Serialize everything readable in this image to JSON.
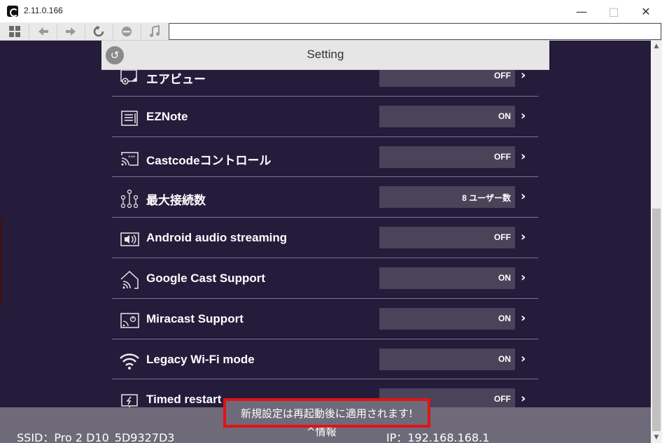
{
  "window": {
    "title": "2.11.0.166",
    "minimize": "—",
    "maximize": "□",
    "close": "✕"
  },
  "toolbar": {
    "url_value": ""
  },
  "header": {
    "title": "Setting"
  },
  "settings": [
    {
      "label": "エアビュー",
      "value": "OFF",
      "icon": "airview-icon"
    },
    {
      "label": "EZNote",
      "value": "ON",
      "icon": "note-icon"
    },
    {
      "label": "Castcodeコントロール",
      "value": "OFF",
      "icon": "castcode-icon"
    },
    {
      "label": "最大接続数",
      "value": "8 ユーザー数",
      "icon": "network-icon"
    },
    {
      "label": "Android audio streaming",
      "value": "OFF",
      "icon": "speaker-icon"
    },
    {
      "label": "Google Cast Support",
      "value": "ON",
      "icon": "home-cast-icon"
    },
    {
      "label": "Miracast Support",
      "value": "ON",
      "icon": "miracast-icon"
    },
    {
      "label": "Legacy Wi-Fi mode",
      "value": "ON",
      "icon": "wifi-icon"
    },
    {
      "label": "Timed restart",
      "value": "OFF",
      "icon": "restart-monitor-icon"
    }
  ],
  "footer": {
    "ssid": "SSID：Pro 2 D10_5D9327D3",
    "info": "^情報",
    "ip": "IP：192.168.168.1",
    "notice": "新規設定は再起動後に適用されます!"
  },
  "colors": {
    "background": "#241c3a",
    "value_box": "#4a4359",
    "footer": "#6f6a79",
    "highlight": "#e01414"
  }
}
